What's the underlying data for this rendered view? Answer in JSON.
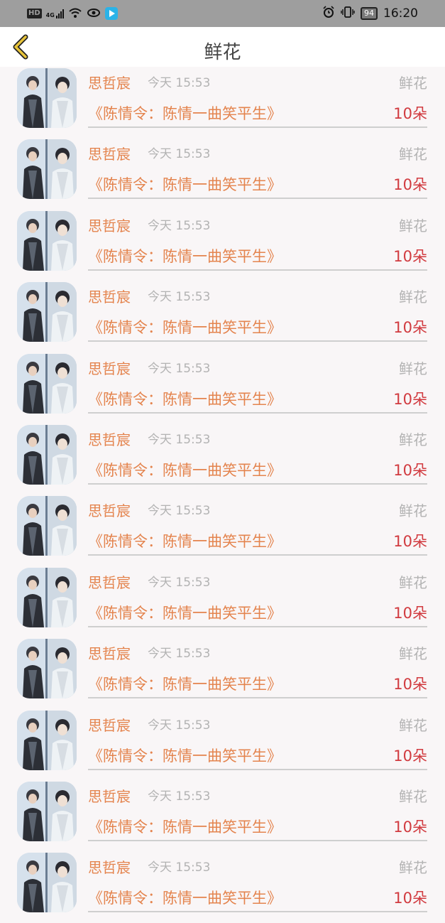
{
  "status_bar": {
    "network": "HD",
    "signal": "4G",
    "time": "16:20",
    "battery": "94"
  },
  "header": {
    "title": "鲜花"
  },
  "rows": [
    {
      "name": "思哲宸",
      "time": "今天 15:53",
      "type": "鲜花",
      "work": "《陈情令：陈情一曲笑平生》",
      "count": "10朵"
    },
    {
      "name": "思哲宸",
      "time": "今天 15:53",
      "type": "鲜花",
      "work": "《陈情令：陈情一曲笑平生》",
      "count": "10朵"
    },
    {
      "name": "思哲宸",
      "time": "今天 15:53",
      "type": "鲜花",
      "work": "《陈情令：陈情一曲笑平生》",
      "count": "10朵"
    },
    {
      "name": "思哲宸",
      "time": "今天 15:53",
      "type": "鲜花",
      "work": "《陈情令：陈情一曲笑平生》",
      "count": "10朵"
    },
    {
      "name": "思哲宸",
      "time": "今天 15:53",
      "type": "鲜花",
      "work": "《陈情令：陈情一曲笑平生》",
      "count": "10朵"
    },
    {
      "name": "思哲宸",
      "time": "今天 15:53",
      "type": "鲜花",
      "work": "《陈情令：陈情一曲笑平生》",
      "count": "10朵"
    },
    {
      "name": "思哲宸",
      "time": "今天 15:53",
      "type": "鲜花",
      "work": "《陈情令：陈情一曲笑平生》",
      "count": "10朵"
    },
    {
      "name": "思哲宸",
      "time": "今天 15:53",
      "type": "鲜花",
      "work": "《陈情令：陈情一曲笑平生》",
      "count": "10朵"
    },
    {
      "name": "思哲宸",
      "time": "今天 15:53",
      "type": "鲜花",
      "work": "《陈情令：陈情一曲笑平生》",
      "count": "10朵"
    },
    {
      "name": "思哲宸",
      "time": "今天 15:53",
      "type": "鲜花",
      "work": "《陈情令：陈情一曲笑平生》",
      "count": "10朵"
    },
    {
      "name": "思哲宸",
      "time": "今天 15:53",
      "type": "鲜花",
      "work": "《陈情令：陈情一曲笑平生》",
      "count": "10朵"
    },
    {
      "name": "思哲宸",
      "time": "今天 15:53",
      "type": "鲜花",
      "work": "《陈情令：陈情一曲笑平生》",
      "count": "10朵"
    }
  ],
  "colors": {
    "accent": "#e4844e",
    "count": "#d13a3f",
    "muted": "#b3b3b3",
    "back_icon": "#e8c43a"
  },
  "icons": {
    "back": "chevron-left-icon"
  }
}
